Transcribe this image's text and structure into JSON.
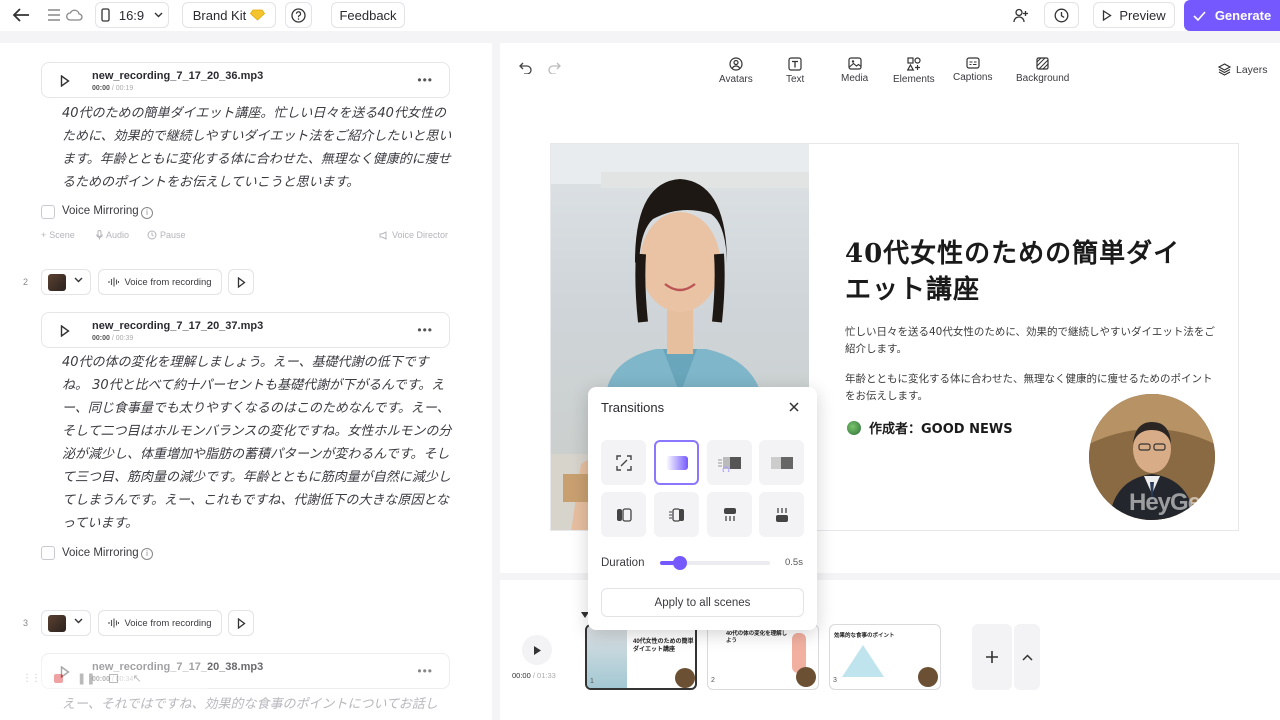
{
  "topbar": {
    "aspect_ratio": "16:9",
    "brand_kit": "Brand Kit",
    "feedback": "Feedback",
    "preview": "Preview",
    "generate": "Generate"
  },
  "toolbar": {
    "avatars": "Avatars",
    "text": "Text",
    "media": "Media",
    "elements": "Elements",
    "captions": "Captions",
    "background": "Background",
    "layers": "Layers"
  },
  "scenes": [
    {
      "file": "new_recording_7_17_20_36.mp3",
      "time_current": "00:00",
      "time_total": "/ 00:19",
      "script": "40代のための簡単ダイエット講座。忙しい日々を送る40代女性のために、効果的で継続しやすいダイエット法をご紹介したいと思います。年齢とともに変化する体に合わせた、無理なく健康的に痩せるためのポイントをお伝えしていこうと思います。",
      "voice_mirroring": "Voice Mirroring"
    },
    {
      "number": "2",
      "voice_label": "Voice from recording",
      "file": "new_recording_7_17_20_37.mp3",
      "time_current": "00:00",
      "time_total": "/ 00:39",
      "script": "40代の体の変化を理解しましょう。えー、基礎代謝の低下ですね。 30代と比べて約十パーセントも基礎代謝が下がるんです。えー、同じ食事量でも太りやすくなるのはこのためなんです。えー、そして二つ目はホルモンバランスの変化ですね。女性ホルモンの分泌が減少し、体重増加や脂肪の蓄積パターンが変わるんです。そして三つ目、筋肉量の減少です。年齢とともに筋肉量が自然に減少してしまうんです。えー、これもですね、代謝低下の大きな原因となっています。",
      "voice_mirroring": "Voice Mirroring"
    },
    {
      "number": "3",
      "voice_label": "Voice from recording",
      "file": "new_recording_7_17_20_38.mp3",
      "time_current": "00:00",
      "time_total": "/ 00:34",
      "script": "えー、それではですね、効果的な食事のポイントについてお話し"
    }
  ],
  "scene_tools": {
    "scene": "Scene",
    "audio": "Audio",
    "pause": "Pause",
    "voice_director": "Voice Director"
  },
  "slide": {
    "title": "40代女性のための簡単ダイエット講座",
    "para1": "忙しい日々を送る40代女性のために、効果的で継続しやすいダイエット法をご紹介します。",
    "para2": "年齢とともに変化する体に合わせた、無理なく健康的に痩せるためのポイントをお伝えします。",
    "author": "作成者：GOOD NEWS",
    "watermark": "HeyGen"
  },
  "transitions": {
    "title": "Transitions",
    "duration_label": "Duration",
    "duration_value": "0.5s",
    "duration_fraction": 0.18,
    "apply_all": "Apply to all scenes",
    "selected_index": 1
  },
  "timeline": {
    "time_current": "00:00",
    "time_total": "/ 01:33",
    "thumbs": [
      {
        "number": "1",
        "title": "40代女性のための簡単ダイエット講座"
      },
      {
        "number": "2",
        "title": "40代の体の変化を理解しよう"
      },
      {
        "number": "3",
        "title": "効果的な食事のポイント"
      }
    ]
  },
  "colors": {
    "accent": "#7559ff",
    "selected_border": "#8a76ff"
  }
}
